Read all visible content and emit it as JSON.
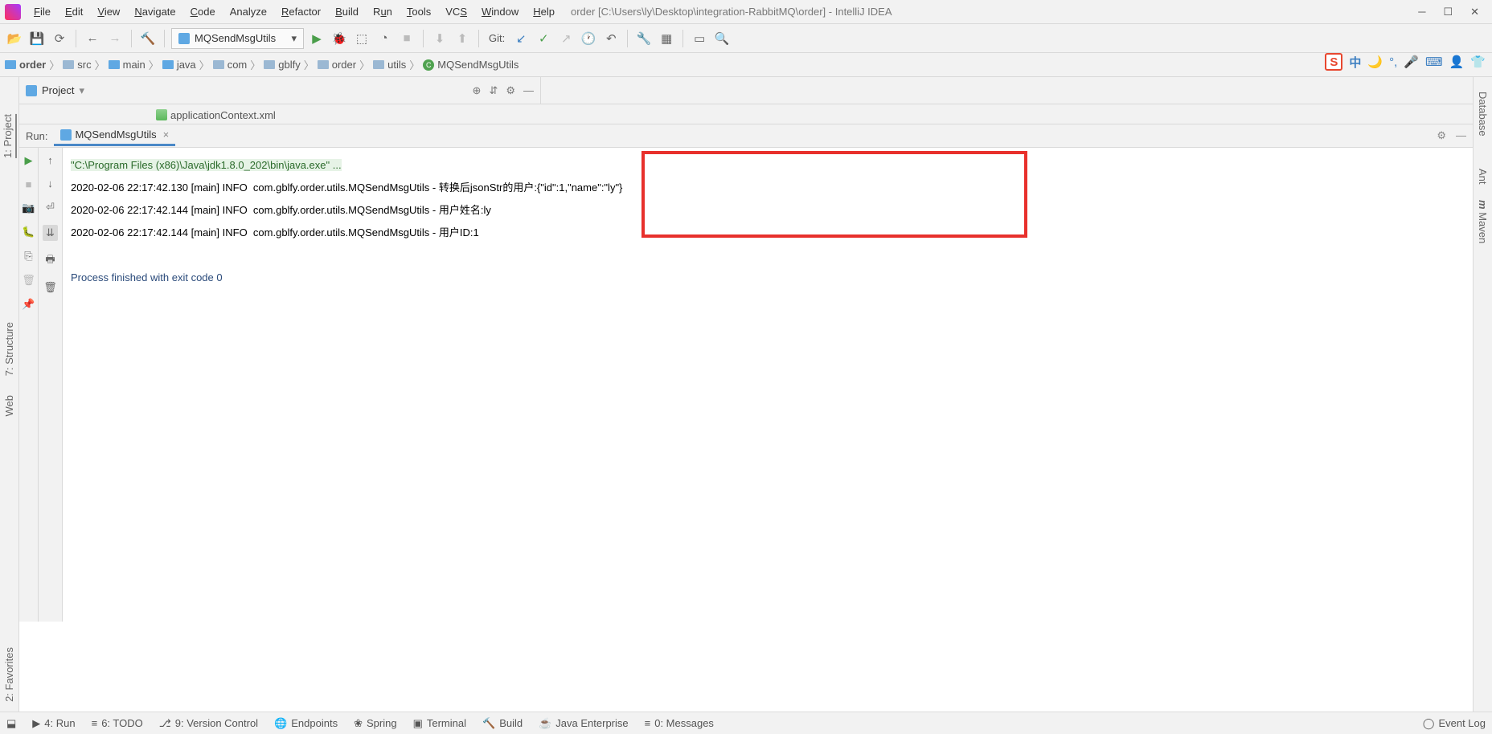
{
  "menu": {
    "file": "File",
    "edit": "Edit",
    "view": "View",
    "navigate": "Navigate",
    "code": "Code",
    "analyze": "Analyze",
    "refactor": "Refactor",
    "build": "Build",
    "run": "Run",
    "tools": "Tools",
    "vcs": "VCS",
    "window": "Window",
    "help": "Help"
  },
  "title": "order [C:\\Users\\ly\\Desktop\\integration-RabbitMQ\\order] - IntelliJ IDEA",
  "runConfig": "MQSendMsgUtils",
  "gitLabel": "Git:",
  "breadcrumb": [
    "order",
    "src",
    "main",
    "java",
    "com",
    "gblfy",
    "order",
    "utils",
    "MQSendMsgUtils"
  ],
  "projectLabel": "Project",
  "openFile": "applicationContext.xml",
  "runLabel": "Run:",
  "runTab": "MQSendMsgUtils",
  "console": {
    "cmd": "\"C:\\Program Files (x86)\\Java\\jdk1.8.0_202\\bin\\java.exe\" ...",
    "l1a": "2020-02-06 22:17:42.130 [main] INFO  com.gblfy.order.utils.MQSendMsgUtils - ",
    "l1b": "转换后jsonStr的用户:{\"id\":1,\"name\":\"ly\"}",
    "l2a": "2020-02-06 22:17:42.144 [main] INFO  com.gblfy.order.utils.MQSendMsgUtils - ",
    "l2b": "用户姓名:ly",
    "l3a": "2020-02-06 22:17:42.144 [main] INFO  com.gblfy.order.utils.MQSendMsgUtils - ",
    "l3b": "用户ID:1",
    "exit": "Process finished with exit code 0"
  },
  "leftTools": {
    "project": "1: Project",
    "structure": "7: Structure",
    "web": "Web",
    "favorites": "2: Favorites"
  },
  "rightTools": {
    "database": "Database",
    "ant": "Ant",
    "maven": "Maven"
  },
  "status": {
    "run": "4: Run",
    "todo": "6: TODO",
    "vc": "9: Version Control",
    "ep": "Endpoints",
    "spring": "Spring",
    "term": "Terminal",
    "build": "Build",
    "je": "Java Enterprise",
    "msg": "0: Messages",
    "log": "Event Log"
  },
  "ime": {
    "s": "S",
    "zh": "中"
  }
}
